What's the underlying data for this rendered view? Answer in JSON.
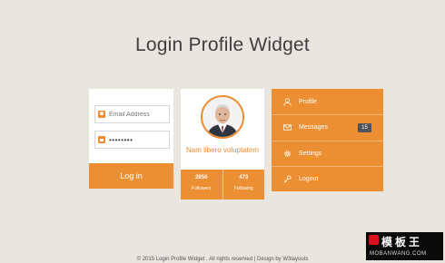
{
  "page": {
    "title": "Login Profile Widget",
    "footer": "© 2015 Login Profile Widget . All rights reserved | Design by W3layouts"
  },
  "login": {
    "email_placeholder": "Email Address",
    "email_icon": "user-icon",
    "password_value": "password",
    "password_icon": "lock-icon",
    "button_label": "Log in"
  },
  "profile": {
    "name": "Nam libero voluptatem",
    "stats": [
      {
        "value": "2850",
        "label": "Followers"
      },
      {
        "value": "473",
        "label": "Following"
      }
    ]
  },
  "menu": {
    "items": [
      {
        "label": "Profile",
        "icon": "user-icon"
      },
      {
        "label": "Messages",
        "icon": "envelope-icon",
        "badge": "15"
      },
      {
        "label": "Settings",
        "icon": "gear-icon"
      },
      {
        "label": "Logout",
        "icon": "key-icon"
      }
    ]
  },
  "watermark": {
    "top": "模板王",
    "bottom": "MOBANWANG.COM"
  },
  "colors": {
    "background": "#e9e6e0",
    "accent": "#ec8f32",
    "badge": "#51535a"
  }
}
